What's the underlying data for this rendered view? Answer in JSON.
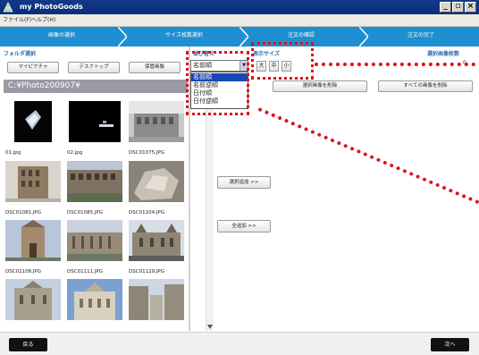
{
  "window": {
    "title": "my PhotoGoods"
  },
  "menu": [
    "ファイル(F)",
    "ヘルプ(H)"
  ],
  "steps": [
    "画像の選択",
    "サイズ枚数選択",
    "注文の確認",
    "注文の完了"
  ],
  "folder_panel": {
    "label": "フォルダ選択",
    "buttons": [
      "マイピクチャ",
      "デスクトップ",
      "保管画像"
    ],
    "path": "C:¥Photo200907¥"
  },
  "thumbnails": [
    "01.jpg",
    "02.jpg",
    "DSC01075.JPG",
    "DSC01081.JPG",
    "DSC01085.JPG",
    "DSC01104.JPG",
    "DSC01108.JPG",
    "DSC01111.JPG",
    "DSC01129.JPG",
    "",
    "",
    ""
  ],
  "sort": {
    "label": "並び替え",
    "selected": "名前順",
    "options": [
      "名前順",
      "名前逆順",
      "日付順",
      "日付逆順"
    ]
  },
  "display_size": {
    "label": "表示サイズ",
    "buttons": [
      "大",
      "中",
      "小"
    ]
  },
  "selection": {
    "count_label": "選択画像枚数",
    "count_value": "0",
    "delete_selected": "選択画像を削除",
    "delete_all": "すべての画像を削除"
  },
  "actions": {
    "add_selected": "選択追加 >>",
    "add_all": "全追加 >>"
  },
  "nav": {
    "back": "戻る",
    "next": "次へ"
  }
}
